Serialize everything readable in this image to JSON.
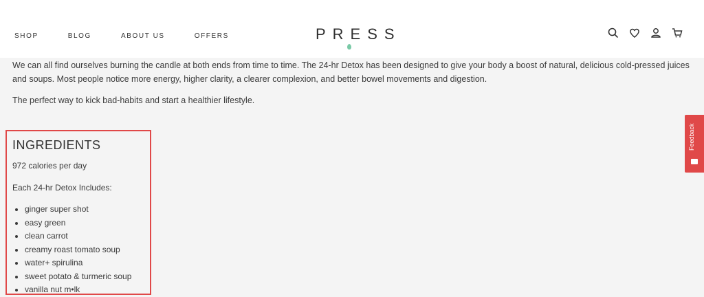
{
  "header": {
    "nav": [
      "SHOP",
      "BLOG",
      "ABOUT US",
      "OFFERS"
    ],
    "logo": "PRESS",
    "icons": [
      "search-icon",
      "heart-icon",
      "user-icon",
      "cart-icon"
    ]
  },
  "content": {
    "para1": "We can all find ourselves burning the candle at both ends from time to time. The 24-hr Detox has been designed to give your body a boost of natural, delicious cold-pressed juices and soups. Most people notice more energy, higher clarity, a clearer complexion, and better bowel movements and digestion.",
    "para2": "The perfect way to kick bad-habits and start a healthier lifestyle."
  },
  "ingredients": {
    "title": "INGREDIENTS",
    "calories": "972 calories per day",
    "includes": "Each 24-hr Detox Includes:",
    "items": [
      "ginger super shot",
      "easy green",
      "clean carrot",
      "creamy roast tomato soup",
      "water+ spirulina",
      "sweet potato & turmeric soup",
      "vanilla nut m•lk"
    ]
  },
  "feedback": {
    "label": "Feedback"
  },
  "colors": {
    "accent": "#e04848",
    "logo_drop": "#79c9a6"
  }
}
